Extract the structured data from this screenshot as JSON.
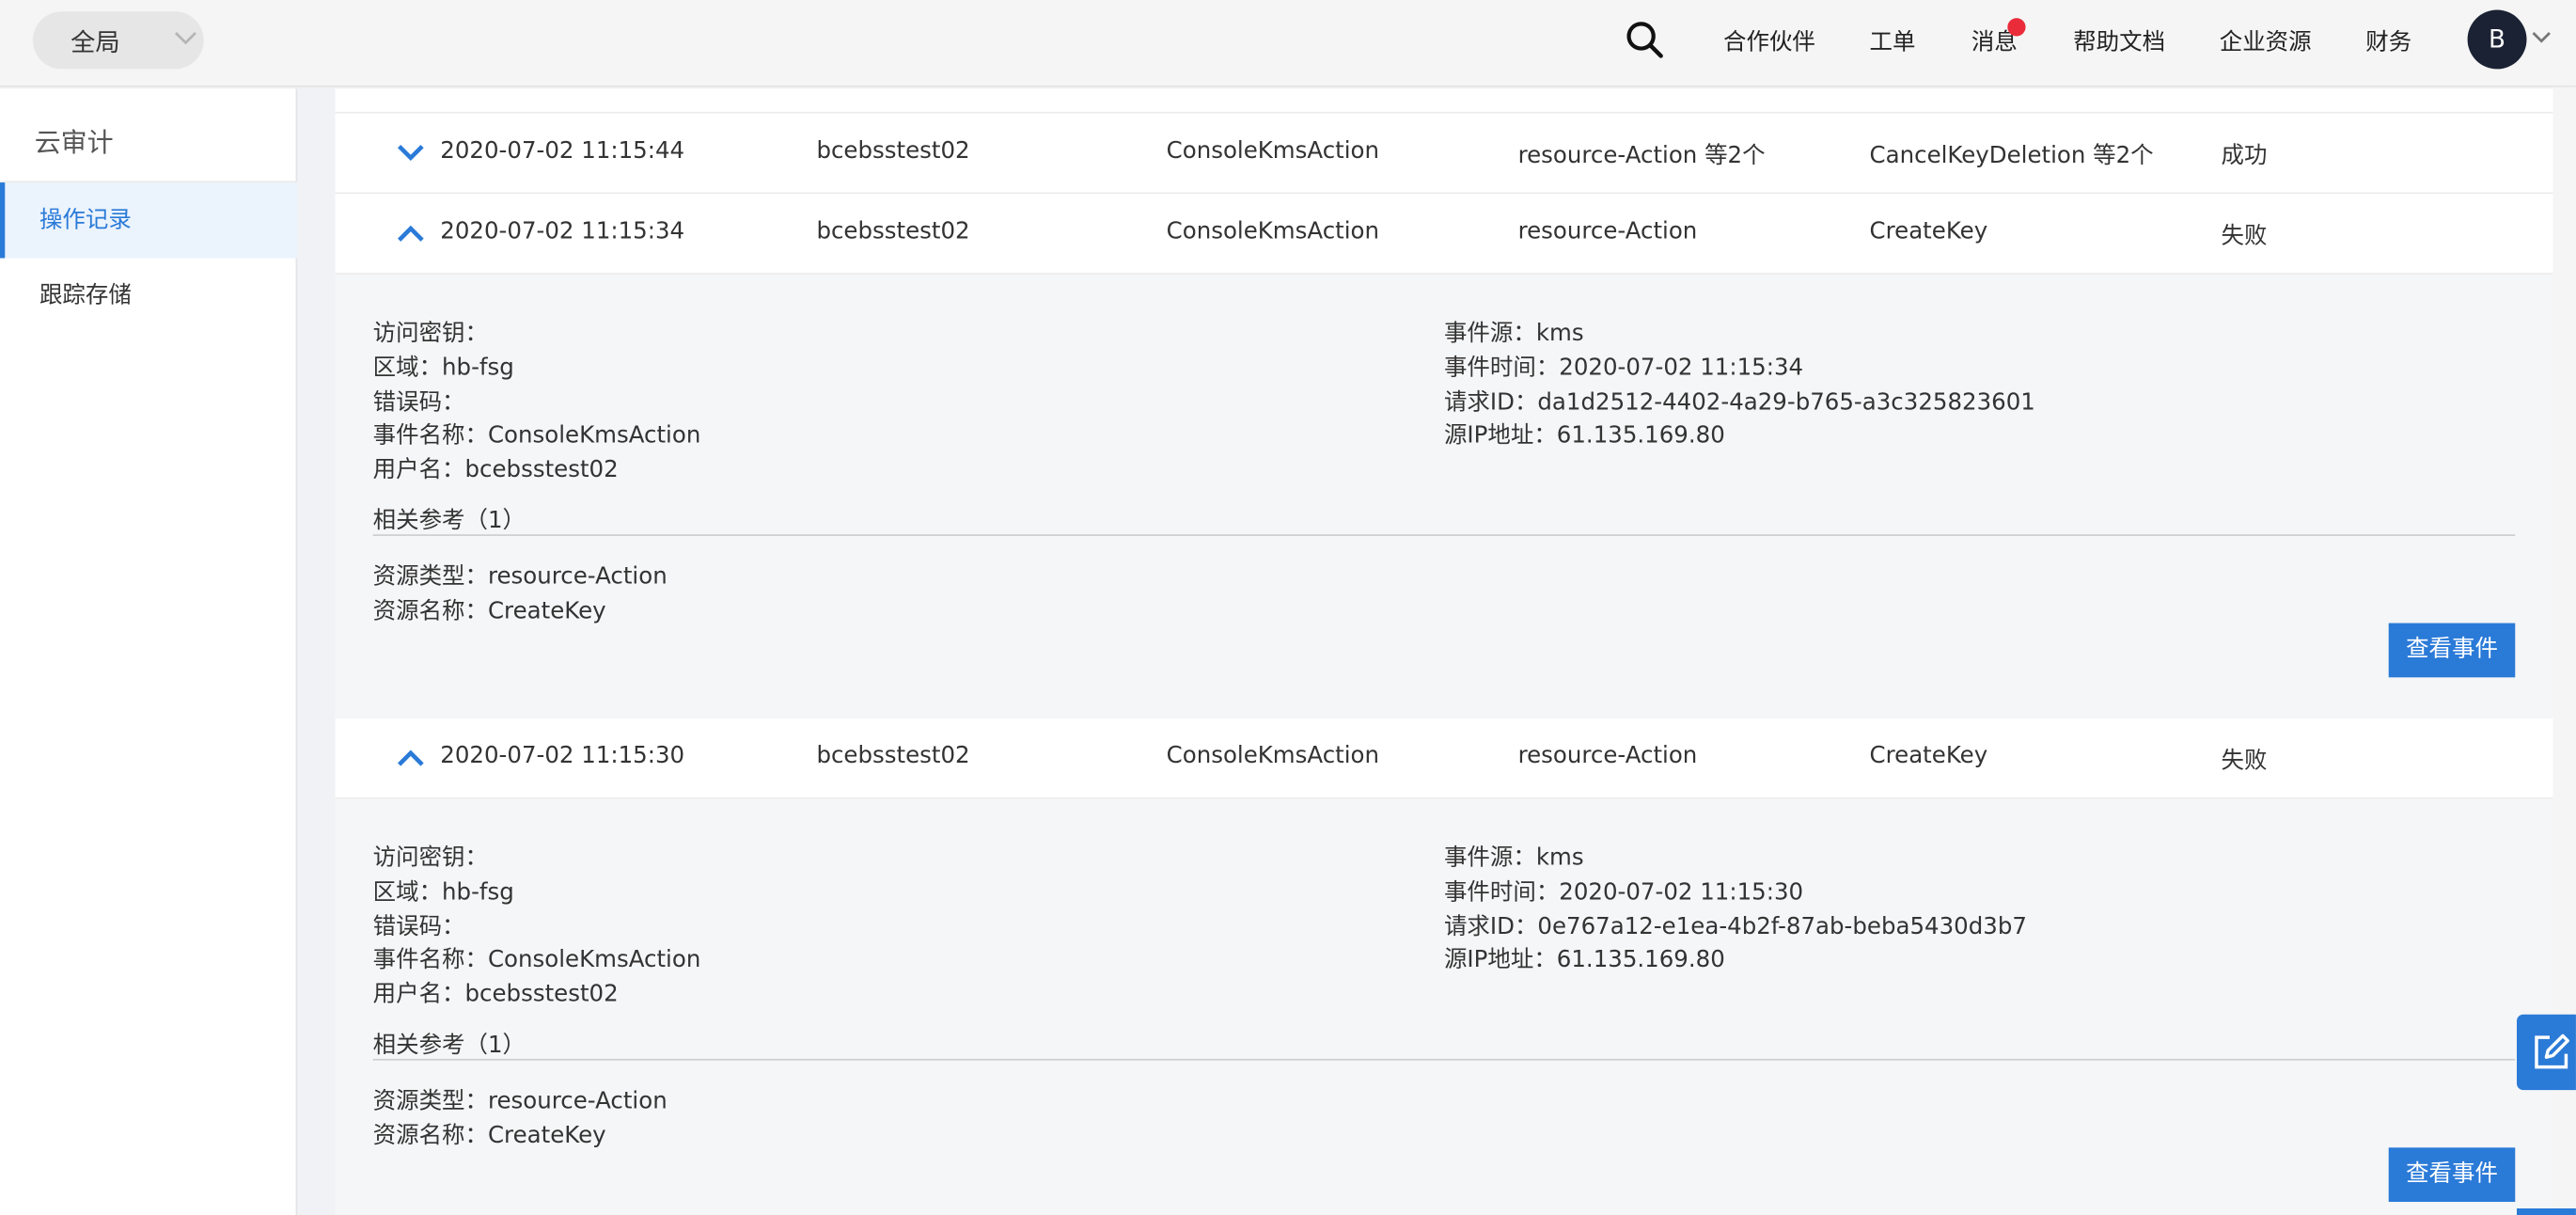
{
  "topbar": {
    "region": "全局",
    "nav": [
      "合作伙伴",
      "工单",
      "消息",
      "帮助文档",
      "企业资源",
      "财务"
    ],
    "avatar_letter": "B",
    "notification_color": "#ea2b3a"
  },
  "sidebar": {
    "title": "云审计",
    "items": [
      {
        "label": "操作记录",
        "active": true
      },
      {
        "label": "跟踪存储",
        "active": false
      }
    ]
  },
  "theme": {
    "accent": "#2a7ad8"
  },
  "records": [
    {
      "expanded": false,
      "time": "2020-07-02 11:15:44",
      "user": "bcebsstest02",
      "event": "ConsoleKmsAction",
      "resource_type": "resource-Action 等2个",
      "resource_name": "CancelKeyDeletion 等2个",
      "status": "成功"
    },
    {
      "expanded": true,
      "time": "2020-07-02 11:15:34",
      "user": "bcebsstest02",
      "event": "ConsoleKmsAction",
      "resource_type": "resource-Action",
      "resource_name": "CreateKey",
      "status": "失败",
      "detail": {
        "left": [
          "访问密钥：",
          "区域：hb-fsg",
          "错误码：",
          "事件名称：ConsoleKmsAction",
          "用户名：bcebsstest02"
        ],
        "right": [
          "事件源：kms",
          "事件时间：2020-07-02 11:15:34",
          "请求ID：da1d2512-4402-4a29-b765-a3c325823601",
          "源IP地址：61.135.169.80"
        ],
        "ref_title": "相关参考（1）",
        "refs": [
          "资源类型：resource-Action",
          "资源名称：CreateKey"
        ],
        "button": "查看事件"
      }
    },
    {
      "expanded": true,
      "time": "2020-07-02 11:15:30",
      "user": "bcebsstest02",
      "event": "ConsoleKmsAction",
      "resource_type": "resource-Action",
      "resource_name": "CreateKey",
      "status": "失败",
      "detail": {
        "left": [
          "访问密钥：",
          "区域：hb-fsg",
          "错误码：",
          "事件名称：ConsoleKmsAction",
          "用户名：bcebsstest02"
        ],
        "right": [
          "事件源：kms",
          "事件时间：2020-07-02 11:15:30",
          "请求ID：0e767a12-e1ea-4b2f-87ab-beba5430d3b7",
          "源IP地址：61.135.169.80"
        ],
        "ref_title": "相关参考（1）",
        "refs": [
          "资源类型：resource-Action",
          "资源名称：CreateKey"
        ],
        "button": "查看事件"
      }
    }
  ]
}
